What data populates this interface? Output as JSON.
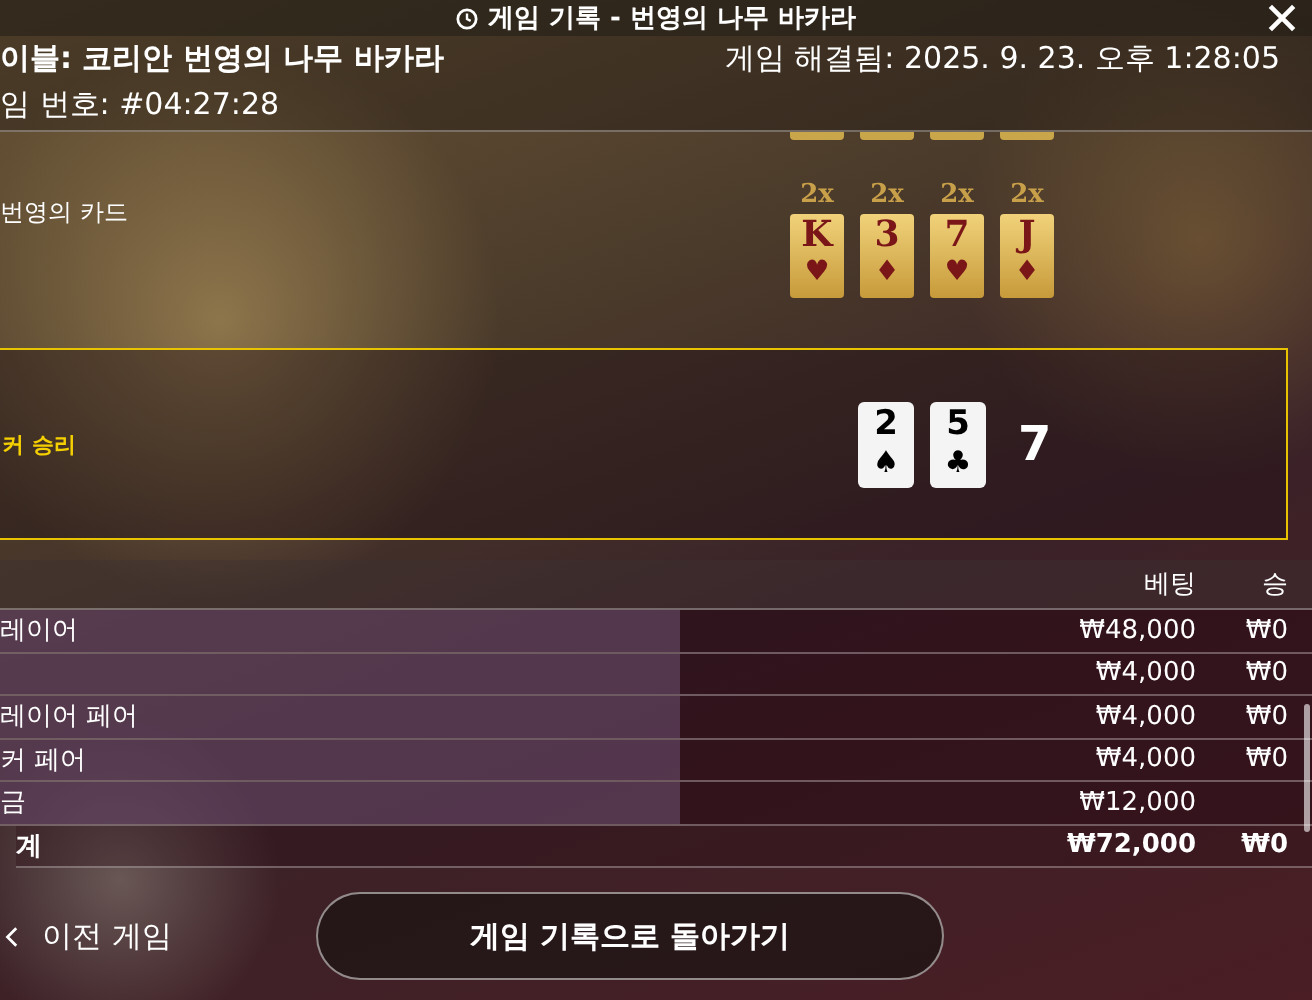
{
  "window": {
    "title": "게임 기록 - 번영의 나무 바카라"
  },
  "info": {
    "table": "이블: 코리안 번영의 나무 바카라",
    "resolved": "게임 해결됨: 2025. 9. 23. 오후 1:28:05",
    "game_number": "임 번호: #04:27:28"
  },
  "bonus": {
    "label": "번영의 카드",
    "cards": [
      {
        "multiplier": "2x",
        "rank": "K",
        "suit": "♥",
        "color": "#7a1518"
      },
      {
        "multiplier": "2x",
        "rank": "3",
        "suit": "♦",
        "color": "#7a1518"
      },
      {
        "multiplier": "2x",
        "rank": "7",
        "suit": "♥",
        "color": "#7a1518"
      },
      {
        "multiplier": "2x",
        "rank": "J",
        "suit": "♦",
        "color": "#7a1518"
      }
    ]
  },
  "result": {
    "label": "커 승리",
    "cards": [
      {
        "rank": "2",
        "suit": "♠",
        "color": "#000000"
      },
      {
        "rank": "5",
        "suit": "♣",
        "color": "#000000"
      }
    ],
    "total": "7"
  },
  "bets": {
    "columns": [
      "베팅",
      "승"
    ],
    "rows": [
      {
        "kind": "bet",
        "name": "레이어",
        "bet": "₩48,000",
        "win": "₩0"
      },
      {
        "kind": "bet",
        "bet": "₩4,000",
        "win": "₩0"
      },
      {
        "kind": "bet",
        "name": "레이어 페어",
        "bet": "₩4,000",
        "win": "₩0"
      },
      {
        "kind": "bet",
        "name": "커 페어",
        "bet": "₩4,000",
        "win": "₩0"
      },
      {
        "kind": "bet",
        "name": "금",
        "bet": "₩12,000"
      },
      {
        "kind": "total",
        "name": "계",
        "bet": "₩72,000",
        "win": "₩0"
      }
    ]
  },
  "footer": {
    "previous": "이전 게임",
    "back_button": "게임 기록으로 돌아가기"
  }
}
